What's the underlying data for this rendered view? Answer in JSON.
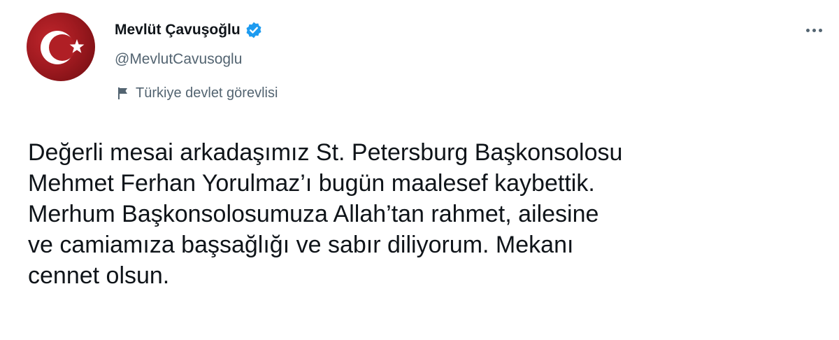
{
  "author": {
    "display_name": "Mevlüt Çavuşoğlu",
    "handle": "@MevlutCavusoglu",
    "label": "Türkiye devlet görevlisi",
    "avatar_icon": "turkish-flag-avatar",
    "verified_icon": "verified-badge-icon",
    "verified_color": "#1d9bf0"
  },
  "more_icon": "more-options-icon",
  "tweet": {
    "lines": [
      "Değerli mesai arkadaşımız St. Petersburg Başkonsolosu",
      "Mehmet Ferhan Yorulmaz’ı bugün maalesef kaybettik.",
      "Merhum Başkonsolosumuza Allah’tan rahmet, ailesine",
      "ve camiamıza başsağlığı ve sabır diliyorum. Mekanı",
      "cennet olsun."
    ]
  },
  "colors": {
    "text": "#0f1419",
    "secondary": "#536471",
    "flag_red": "#c0262c"
  }
}
